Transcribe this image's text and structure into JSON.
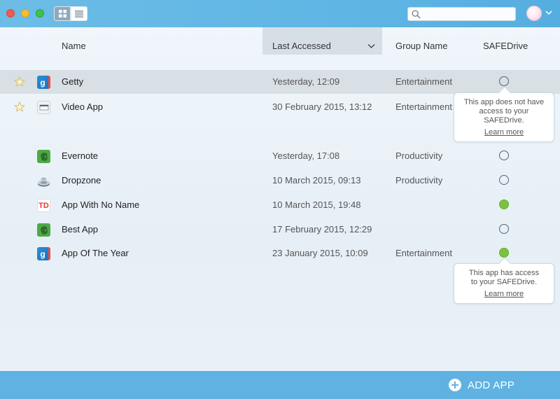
{
  "toolbar": {
    "search_placeholder": "",
    "view_modes": [
      "grid-icon",
      "list-icon"
    ],
    "active_view": "list"
  },
  "columns": {
    "name": "Name",
    "last_accessed": "Last Accessed",
    "group_name": "Group Name",
    "safedrive": "SAFEDrive",
    "sorted_by": "last_accessed"
  },
  "rows": [
    {
      "name": "Getty",
      "date": "Yesterday, 12:09",
      "group": "Entertainment",
      "favorite": true,
      "safedrive": false,
      "icon": "getty-icon",
      "selected": true
    },
    {
      "name": "Video App",
      "date": "30 February 2015, 13:12",
      "group": "Entertainment",
      "favorite": true,
      "safedrive": false,
      "icon": "video-app-icon",
      "selected": false
    },
    {
      "name": "Evernote",
      "date": "Yesterday, 17:08",
      "group": "Productivity",
      "favorite": false,
      "safedrive": false,
      "icon": "evernote-icon",
      "selected": false
    },
    {
      "name": "Dropzone",
      "date": "10 March 2015, 09:13",
      "group": "Productivity",
      "favorite": false,
      "safedrive": false,
      "icon": "dropzone-icon",
      "selected": false
    },
    {
      "name": "App With No Name",
      "date": "10 March 2015, 19:48",
      "group": "",
      "favorite": false,
      "safedrive": true,
      "icon": "td-icon",
      "selected": false
    },
    {
      "name": "Best App",
      "date": "17 February 2015, 12:29",
      "group": "",
      "favorite": false,
      "safedrive": false,
      "icon": "evernote-icon",
      "selected": false
    },
    {
      "name": "App Of The Year",
      "date": "23 January 2015, 10:09",
      "group": "Entertainment",
      "favorite": false,
      "safedrive": true,
      "icon": "getty-icon",
      "selected": false
    }
  ],
  "tooltips": {
    "no_access": {
      "line1": "This app does not have",
      "line2": "access to your SAFEDrive.",
      "link": "Learn more"
    },
    "has_access": {
      "line1": "This app has access",
      "line2": "to your SAFEDrive.",
      "link": "Learn more"
    }
  },
  "footer": {
    "add_app_label": "ADD APP"
  },
  "colors": {
    "titlebar": "#5fb6e4",
    "footer": "#5fb2e2",
    "access_on": "#7cc23f",
    "selected_row": "#d8dfe5"
  }
}
